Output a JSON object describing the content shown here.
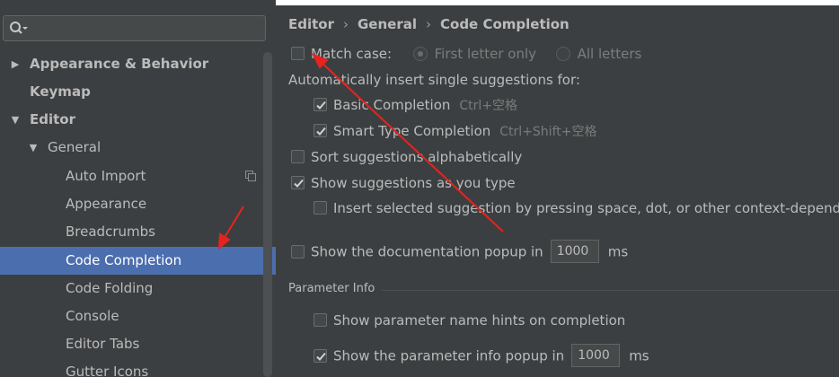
{
  "search": {
    "value": "",
    "placeholder": ""
  },
  "tree": {
    "items": [
      {
        "label": "Appearance & Behavior",
        "arrow": "▶"
      },
      {
        "label": "Keymap"
      },
      {
        "label": "Editor",
        "arrow": "▼"
      },
      {
        "label": "General",
        "arrow": "▼"
      },
      {
        "label": "Auto Import"
      },
      {
        "label": "Appearance"
      },
      {
        "label": "Breadcrumbs"
      },
      {
        "label": "Code Completion"
      },
      {
        "label": "Code Folding"
      },
      {
        "label": "Console"
      },
      {
        "label": "Editor Tabs"
      },
      {
        "label": "Gutter Icons"
      }
    ],
    "selected": "Code Completion"
  },
  "breadcrumb": [
    "Editor",
    "General",
    "Code Completion"
  ],
  "breadcrumb_separator": "›",
  "options": {
    "match_case": {
      "label": "Match case:",
      "checked": false
    },
    "first_letter_only": {
      "label": "First letter only",
      "selected": true
    },
    "all_letters": {
      "label": "All letters",
      "selected": false
    },
    "auto_insert_heading": "Automatically insert single suggestions for:",
    "basic_completion": {
      "label": "Basic Completion",
      "shortcut": "Ctrl+空格",
      "checked": true
    },
    "smart_type_completion": {
      "label": "Smart Type Completion",
      "shortcut": "Ctrl+Shift+空格",
      "checked": true
    },
    "sort_alphabetically": {
      "label": "Sort suggestions alphabetically",
      "checked": false
    },
    "show_as_you_type": {
      "label": "Show suggestions as you type",
      "checked": true
    },
    "insert_selected": {
      "label": "Insert selected suggestion by pressing space, dot, or other context-depende",
      "checked": false
    },
    "doc_popup": {
      "label": "Show the documentation popup in",
      "value": "1000",
      "unit": "ms",
      "checked": false
    }
  },
  "parameter_info": {
    "title": "Parameter Info",
    "name_hints": {
      "label": "Show parameter name hints on completion",
      "checked": false
    },
    "info_popup": {
      "label": "Show the parameter info popup in",
      "value": "1000",
      "unit": "ms",
      "checked": true
    }
  },
  "colors": {
    "background": "#3c3f41",
    "selection": "#4b6eaf",
    "text": "#bbbbbb",
    "annotation_arrow": "#e8231e"
  },
  "icons": [
    "search-icon",
    "expand-arrow-icon",
    "collapse-arrow-icon",
    "copy-icon",
    "checkmark-icon"
  ]
}
